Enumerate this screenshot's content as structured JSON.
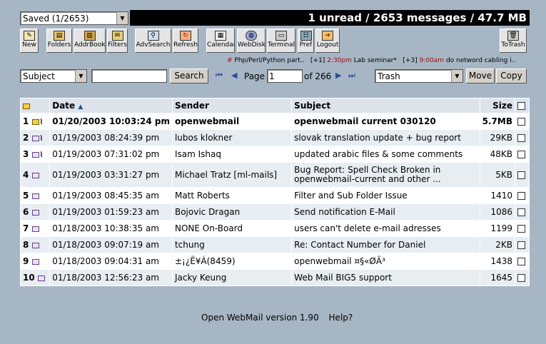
{
  "folder_select": {
    "value": "Saved (1/2653)"
  },
  "banner": {
    "text": "1 unread / 2653 messages / 47.7 MB"
  },
  "toolbar": {
    "new": "New",
    "folders": "Folders",
    "addrbook": "AddrBook",
    "filters": "Filters",
    "advsearch": "AdvSearch",
    "refresh": "Refresh",
    "calendar": "Calendar",
    "webdisk": "WebDisk",
    "terminal": "Terminal",
    "pref": "Pref",
    "logout": "Logout",
    "totrash": "ToTrash"
  },
  "events": {
    "e1_mark": "#",
    "e1_text": "Php/Perl/Python part..",
    "e2_prefix": "[+1]",
    "e2_time": "2:30pm",
    "e2_text": "Lab seminar*",
    "e3_prefix": "[+3]",
    "e3_time": "9:00am",
    "e3_text": "do netword cabling i.."
  },
  "controls": {
    "sort_value": "Subject",
    "search_value": "",
    "search_label": "Search",
    "page_label": "Page",
    "page_value": "1",
    "page_total": "of 266",
    "move_target": "Trash",
    "move_label": "Move",
    "copy_label": "Copy"
  },
  "table": {
    "headers": {
      "date": "Date",
      "sender": "Sender",
      "subject": "Subject",
      "size": "Size"
    },
    "rows": [
      {
        "idx": "1",
        "date": "01/20/2003 10:03:24 pm",
        "sender": "openwebmail",
        "subject": "openwebmail current 030120",
        "size": "5.7MB"
      },
      {
        "idx": "2",
        "date": "01/19/2003 08:24:39 pm",
        "sender": "lubos klokner",
        "subject": "slovak translation update + bug report",
        "size": "29KB"
      },
      {
        "idx": "3",
        "date": "01/19/2003 07:31:02 pm",
        "sender": "Isam Ishaq",
        "subject": "updated arabic files & some comments",
        "size": "48KB"
      },
      {
        "idx": "4",
        "date": "01/19/2003 03:31:27 pm",
        "sender": "Michael Tratz [ml-mails]",
        "subject": "Bug Report: Spell Check Broken in openwebmail-current and other ...",
        "size": "5KB"
      },
      {
        "idx": "5",
        "date": "01/19/2003 08:45:35 am",
        "sender": "Matt Roberts",
        "subject": "Filter and Sub Folder Issue",
        "size": "1410"
      },
      {
        "idx": "6",
        "date": "01/19/2003 01:59:23 am",
        "sender": "Bojovic Dragan",
        "subject": "Send notification E-Mail",
        "size": "1086"
      },
      {
        "idx": "7",
        "date": "01/18/2003 10:38:35 am",
        "sender": "NONE On-Board",
        "subject": "users can't delete e-mail adresses",
        "size": "1199"
      },
      {
        "idx": "8",
        "date": "01/18/2003 09:07:19 am",
        "sender": "tchung",
        "subject": "Re: Contact Number for Daniel",
        "size": "2KB"
      },
      {
        "idx": "9",
        "date": "01/18/2003 09:04:31 am",
        "sender": "±¡¿Ë¥Á(8459)",
        "subject": "openwebmail ¤§«ØÄ³",
        "size": "1438"
      },
      {
        "idx": "10",
        "date": "01/18/2003 12:56:23 am",
        "sender": "Jacky Keung",
        "subject": "Web Mail BIG5 support",
        "size": "1645"
      }
    ]
  },
  "footer": {
    "version": "Open WebMail version 1.90",
    "help": "Help?"
  }
}
